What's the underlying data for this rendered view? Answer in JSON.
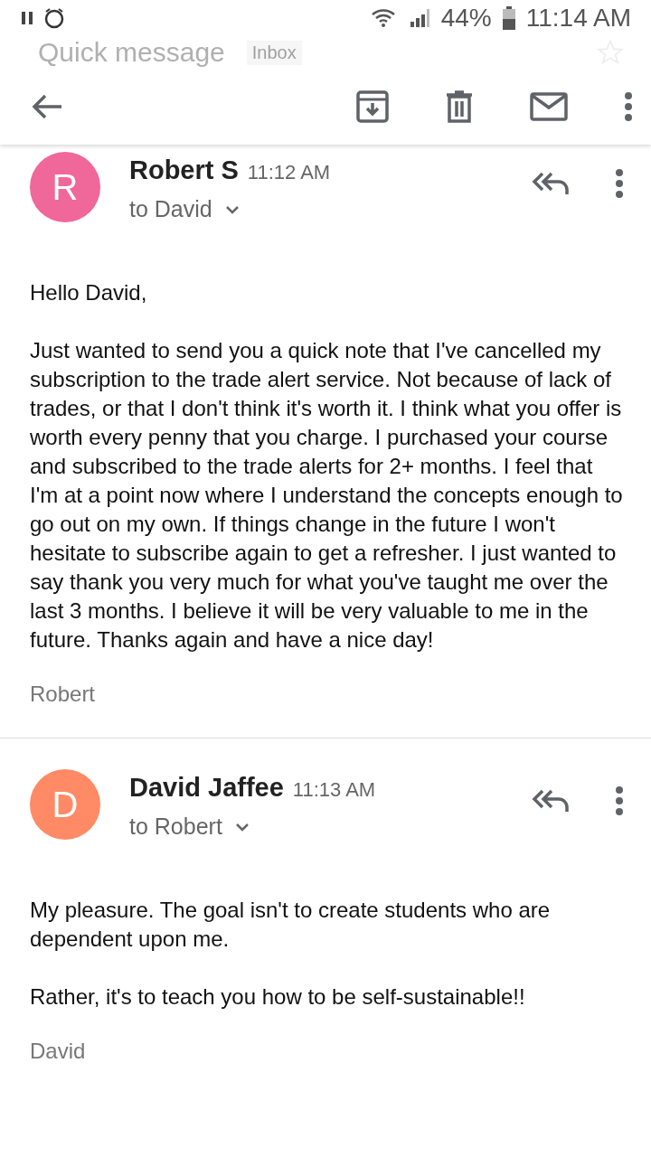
{
  "status_bar": {
    "battery": "44%",
    "time": "11:14 AM"
  },
  "ghost_header": {
    "title": "Quick message",
    "label": "Inbox"
  },
  "messages": [
    {
      "initial": "R",
      "color": "#f0679a",
      "sender": "Robert S",
      "time": "11:12 AM",
      "recipient": "to David",
      "paragraphs": [
        "Hello David,",
        "Just wanted to send you a quick note that I've cancelled my subscription to the trade alert service. Not because of lack of trades, or that I don't think it's worth it.  I think what you offer is worth every penny that you charge.  I purchased your course and subscribed to the trade alerts for 2+ months.  I feel that I'm at a point now where I understand the concepts enough to go out on my own.  If things change in the future I won't hesitate to subscribe again to get a refresher.  I just wanted to say thank you very much for what you've taught me over the last 3 months. I believe it will be very valuable to me in the future.  Thanks again and have a nice day!"
      ],
      "signature": "Robert"
    },
    {
      "initial": "D",
      "color": "#ff8a65",
      "sender": "David Jaffee",
      "time": "11:13 AM",
      "recipient": "to Robert",
      "paragraphs": [
        "My pleasure. The goal isn't to create students who are dependent upon me.",
        "Rather, it's to teach you how to be self-sustainable!!"
      ],
      "signature": "David"
    }
  ]
}
